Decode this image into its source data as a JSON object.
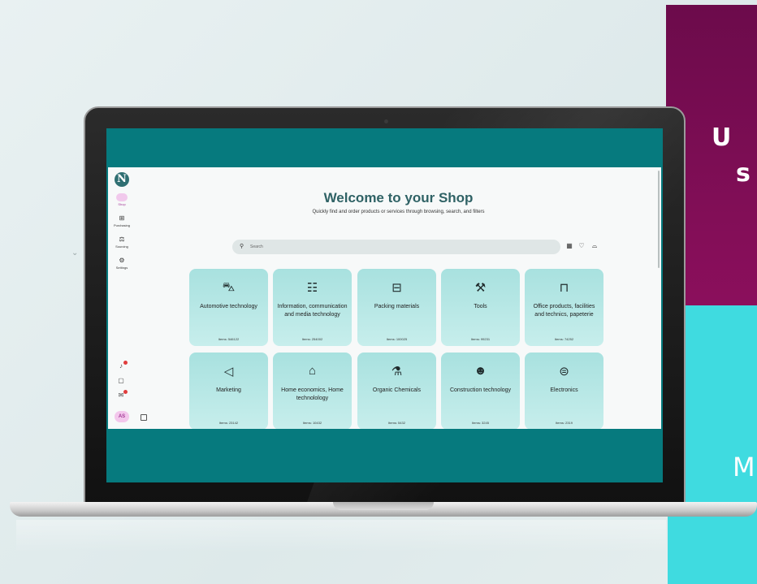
{
  "decoration": {
    "top_text_1": "U",
    "top_text_2": "s",
    "bottom_text": "M",
    "chevron": "⌄"
  },
  "sidebar": {
    "logo": "N",
    "items": [
      {
        "label": "Shop",
        "icon": "shop-icon",
        "glyph": "▆",
        "active": true
      },
      {
        "label": "Purchasing",
        "icon": "cart-icon",
        "glyph": "🛒"
      },
      {
        "label": "Sourcing",
        "icon": "gavel-icon",
        "glyph": "⚖"
      },
      {
        "label": "Settings",
        "icon": "gear-icon",
        "glyph": "⚙"
      }
    ],
    "bottom_icons": [
      {
        "icon": "notifications-icon",
        "glyph": "🔔"
      },
      {
        "icon": "clipboard-icon",
        "glyph": "▢"
      },
      {
        "icon": "messages-icon",
        "glyph": "✉"
      }
    ],
    "avatar": "AS"
  },
  "header": {
    "title": "Welcome to your Shop",
    "subtitle": "Quickly find and order products or services through browsing, search, and filters"
  },
  "search": {
    "placeholder": "Search"
  },
  "toolbar_icons": [
    "grid-icon",
    "heart-icon",
    "bag-icon"
  ],
  "categories": [
    {
      "name": "Automotive technology",
      "count": "Items: 546122",
      "icon": "car-icon",
      "glyph": "🚗"
    },
    {
      "name": "Information, communication and media technology",
      "count": "Items: 254002",
      "icon": "document-person-icon",
      "glyph": "🗒"
    },
    {
      "name": "Packing materials",
      "count": "Items: 100025",
      "icon": "archive-box-icon",
      "glyph": "🗃"
    },
    {
      "name": "Tools",
      "count": "Items: 99231",
      "icon": "tools-icon",
      "glyph": "⚒"
    },
    {
      "name": "Office products, facilities and technics, papeterie",
      "count": "Items: 74252",
      "icon": "desk-icon",
      "glyph": "⌸"
    },
    {
      "name": "Marketing",
      "count": "Items: 23142",
      "icon": "megaphone-icon",
      "glyph": "📣"
    },
    {
      "name": "Home economics, Home technolology",
      "count": "Items: 10432",
      "icon": "house-icon",
      "glyph": "⌂"
    },
    {
      "name": "Organic Chemicals",
      "count": "Items: 5432",
      "icon": "flask-icon",
      "glyph": "⚗"
    },
    {
      "name": "Construction technology",
      "count": "Items: 3245",
      "icon": "worker-icon",
      "glyph": "👷"
    },
    {
      "name": "Electronics",
      "count": "Items: 2319",
      "icon": "plug-icon",
      "glyph": "⏻"
    }
  ]
}
